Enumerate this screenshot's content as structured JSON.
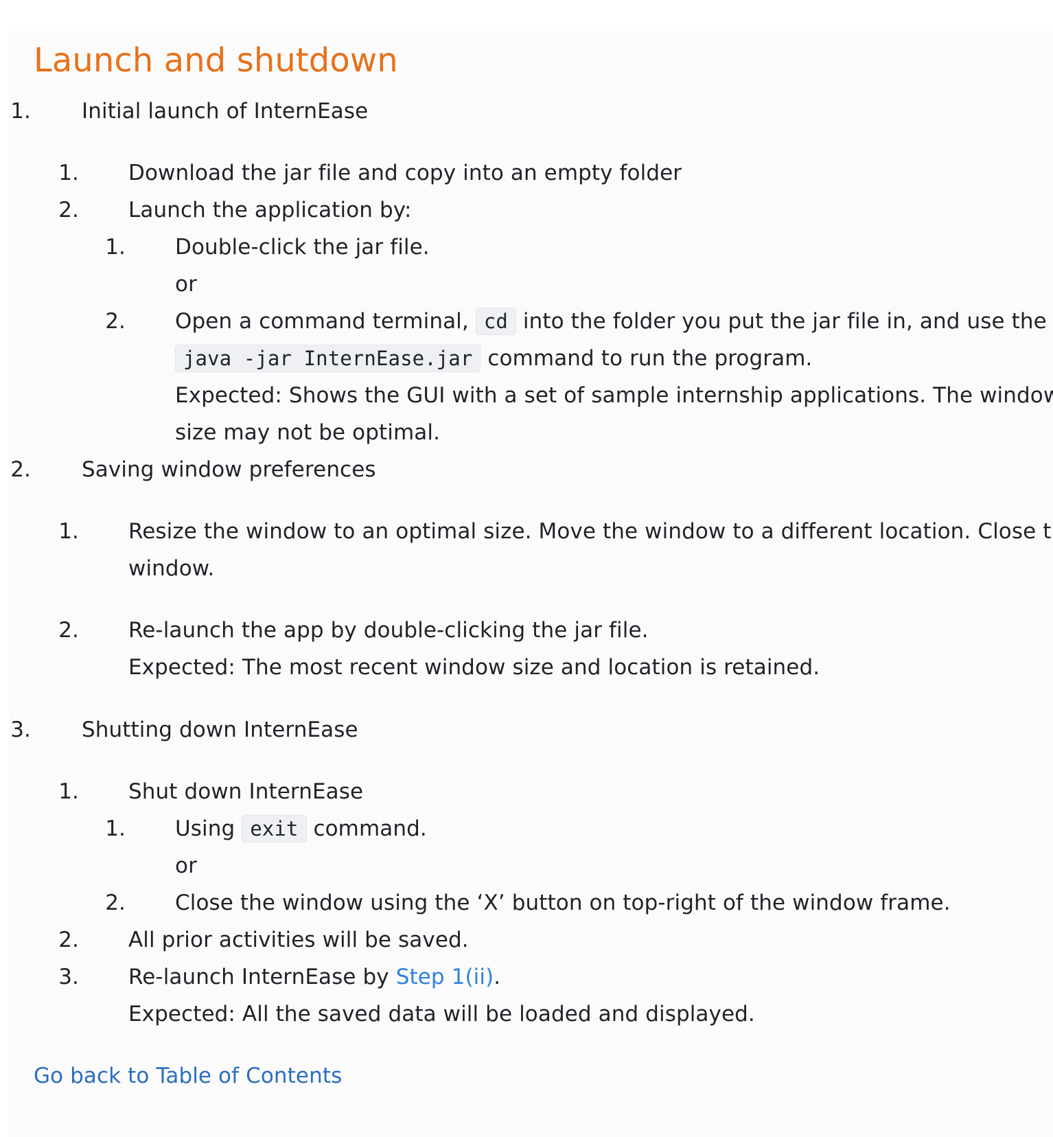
{
  "title": "Launch and shutdown",
  "sections": [
    {
      "num": "1.",
      "label": "Initial launch of InternEase",
      "steps": [
        {
          "num": "1.",
          "text": "Download the jar file and copy into an empty folder"
        },
        {
          "num": "2.",
          "text": "Launch the application by:",
          "options": [
            {
              "num": "1.",
              "text": "Double-click the jar file.",
              "suffix": "or"
            },
            {
              "num": "2.",
              "pre": "Open a command terminal,",
              "code1": "cd",
              "mid": "into the folder you put the jar file in, and use the",
              "code2": "java -jar InternEase.jar",
              "post": "command to run the program.",
              "expected_line1": "Expected: Shows the GUI with a set of sample internship applications. The window",
              "expected_line2": "size may not be optimal."
            }
          ]
        }
      ]
    },
    {
      "num": "2.",
      "label": "Saving window preferences",
      "steps": [
        {
          "num": "1.",
          "line1": "Resize the window to an optimal size. Move the window to a different location. Close the",
          "line2": "window."
        },
        {
          "num": "2.",
          "line1": "Re-launch the app by double-clicking the jar file.",
          "expected": "Expected: The most recent window size and location is retained."
        }
      ]
    },
    {
      "num": "3.",
      "label": "Shutting down InternEase",
      "steps": [
        {
          "num": "1.",
          "text": "Shut down InternEase",
          "options": [
            {
              "num": "1.",
              "pre": "Using",
              "code": "exit",
              "post": "command.",
              "suffix": "or"
            },
            {
              "num": "2.",
              "text": "Close the window using the ‘X’ button on top-right of the window frame."
            }
          ]
        },
        {
          "num": "2.",
          "text": "All prior activities will be saved."
        },
        {
          "num": "3.",
          "pre": "Re-launch InternEase by",
          "link": "Step 1(ii)",
          "post": ".",
          "expected": "Expected: All the saved data will be loaded and displayed."
        }
      ]
    }
  ],
  "back_link": "Go back to Table of Contents",
  "colors": {
    "heading": "#e8711a",
    "link": "#2f81e0",
    "text": "#1f2328",
    "panel": "#fbfbfb"
  }
}
